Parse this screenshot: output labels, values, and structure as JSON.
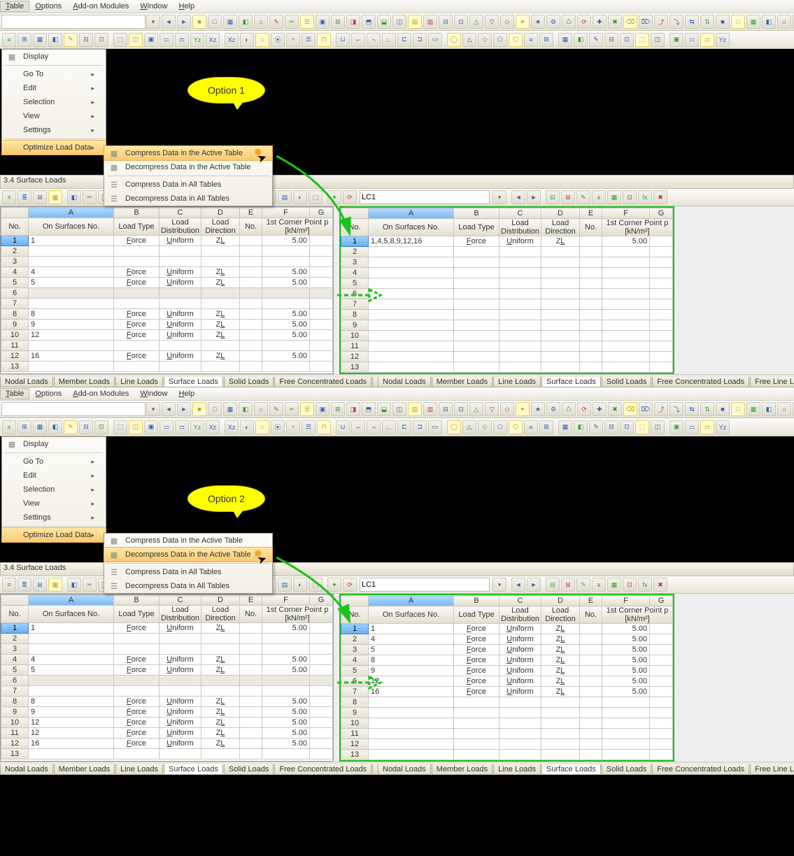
{
  "menubar": [
    "Table",
    "Options",
    "Add-on Modules",
    "Window",
    "Help"
  ],
  "dropdown": {
    "display": "Display",
    "items": [
      "Go To",
      "Edit",
      "Selection",
      "View",
      "Settings"
    ],
    "optimize": "Optimize Load Data"
  },
  "submenu_items": [
    "Compress Data in the Active Table",
    "Decompress Data in the Active Table",
    "Compress Data in All Tables",
    "Decompress Data in All Tables"
  ],
  "callout1": "Option 1",
  "callout2": "Option 2",
  "table_title": "3.4 Surface Loads",
  "lc_combo": "LC1",
  "col_letters": [
    "A",
    "B",
    "C",
    "D",
    "E",
    "F",
    "G"
  ],
  "headers": {
    "no": "No.",
    "surf": "On Surfaces No.",
    "ltype": "Load Type",
    "ldist": "Load\nDistribution",
    "ldir": "Load\nDirection",
    "cno": "No.",
    "corner": "1st Corner Point\np [kN/m²]"
  },
  "vals": {
    "force": "Force",
    "uniform": "Uniform",
    "zl": "ZL"
  },
  "source_rows": [
    {
      "n": 1,
      "s": "1",
      "f": true,
      "p": "5.00"
    },
    {
      "n": 2
    },
    {
      "n": 3
    },
    {
      "n": 4,
      "s": "4",
      "f": true,
      "p": "5.00"
    },
    {
      "n": 5,
      "s": "5",
      "f": true,
      "p": "5.00"
    },
    {
      "n": 6,
      "blank": true
    },
    {
      "n": 7
    },
    {
      "n": 8,
      "s": "8",
      "f": true,
      "p": "5.00"
    },
    {
      "n": 9,
      "s": "9",
      "f": true,
      "p": "5.00"
    },
    {
      "n": 10,
      "s": "12",
      "f": true,
      "p": "5.00"
    },
    {
      "n": 11
    },
    {
      "n": 12,
      "s": "16",
      "f": true,
      "p": "5.00"
    },
    {
      "n": 13
    }
  ],
  "source_rows2": [
    {
      "n": 1,
      "s": "1",
      "f": true,
      "p": "5.00"
    },
    {
      "n": 2
    },
    {
      "n": 3
    },
    {
      "n": 4,
      "s": "4",
      "f": true,
      "p": "5.00"
    },
    {
      "n": 5,
      "s": "5",
      "f": true,
      "p": "5.00"
    },
    {
      "n": 6,
      "blank": true
    },
    {
      "n": 7
    },
    {
      "n": 8,
      "s": "8",
      "f": true,
      "p": "5.00"
    },
    {
      "n": 9,
      "s": "9",
      "f": true,
      "p": "5.00"
    },
    {
      "n": 10,
      "s": "12",
      "f": true,
      "p": "5.00"
    },
    {
      "n": 11,
      "s": "12",
      "f": true,
      "p": "5.00"
    },
    {
      "n": 12,
      "s": "16",
      "f": true,
      "p": "5.00"
    },
    {
      "n": 13
    }
  ],
  "compress_rows": [
    {
      "n": 1,
      "s": "1,4,5,8,9,12,16",
      "f": true,
      "p": "5.00"
    },
    {
      "n": 2
    },
    {
      "n": 3
    },
    {
      "n": 4
    },
    {
      "n": 5
    },
    {
      "n": 6
    },
    {
      "n": 7
    },
    {
      "n": 8
    },
    {
      "n": 9
    },
    {
      "n": 10
    },
    {
      "n": 11
    },
    {
      "n": 12
    },
    {
      "n": 13
    }
  ],
  "decompress_rows": [
    {
      "n": 1,
      "s": "1",
      "f": true,
      "p": "5.00"
    },
    {
      "n": 2,
      "s": "4",
      "f": true,
      "p": "5.00"
    },
    {
      "n": 3,
      "s": "5",
      "f": true,
      "p": "5.00"
    },
    {
      "n": 4,
      "s": "8",
      "f": true,
      "p": "5.00"
    },
    {
      "n": 5,
      "s": "9",
      "f": true,
      "p": "5.00"
    },
    {
      "n": 6,
      "s": "12",
      "f": true,
      "p": "5.00"
    },
    {
      "n": 7,
      "s": "16",
      "f": true,
      "p": "5.00"
    },
    {
      "n": 8
    },
    {
      "n": 9
    },
    {
      "n": 10
    },
    {
      "n": 11
    },
    {
      "n": 12
    },
    {
      "n": 13
    }
  ],
  "tabs": [
    "Nodal Loads",
    "Member Loads",
    "Line Loads",
    "Surface Loads",
    "Solid Loads",
    "Free Concentrated Loads",
    "Free Line Loads"
  ],
  "active_tab": "Surface Loads"
}
